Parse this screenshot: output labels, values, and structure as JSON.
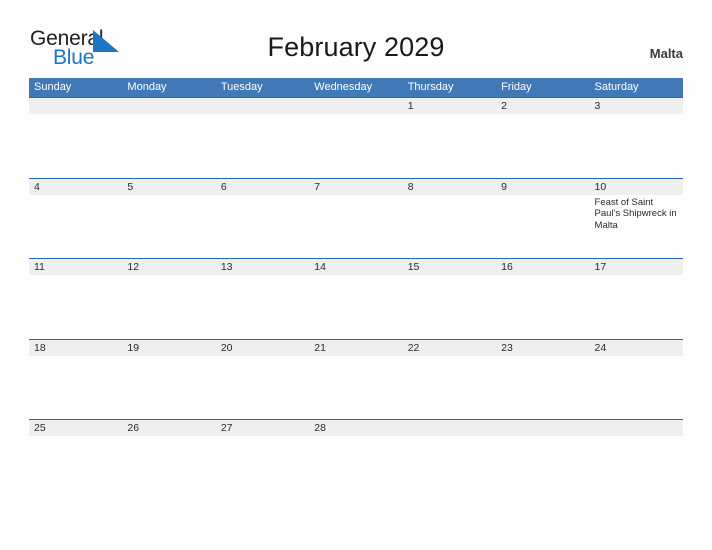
{
  "brand": {
    "name_part1": "General",
    "name_part2": "Blue",
    "triangle_icon": "triangle-right-icon",
    "color_dark": "#231f20",
    "color_blue": "#1c76c5"
  },
  "header": {
    "title": "February 2029",
    "region": "Malta",
    "accent_color": "#4178b8",
    "row_border_color": "#1f6eb5",
    "band_color": "#efefef"
  },
  "weekdays": [
    "Sunday",
    "Monday",
    "Tuesday",
    "Wednesday",
    "Thursday",
    "Friday",
    "Saturday"
  ],
  "weeks": [
    [
      {
        "day": "",
        "event": ""
      },
      {
        "day": "",
        "event": ""
      },
      {
        "day": "",
        "event": ""
      },
      {
        "day": "",
        "event": ""
      },
      {
        "day": "1",
        "event": ""
      },
      {
        "day": "2",
        "event": ""
      },
      {
        "day": "3",
        "event": ""
      }
    ],
    [
      {
        "day": "4",
        "event": ""
      },
      {
        "day": "5",
        "event": ""
      },
      {
        "day": "6",
        "event": ""
      },
      {
        "day": "7",
        "event": ""
      },
      {
        "day": "8",
        "event": ""
      },
      {
        "day": "9",
        "event": ""
      },
      {
        "day": "10",
        "event": "Feast of Saint Paul's Shipwreck in Malta"
      }
    ],
    [
      {
        "day": "11",
        "event": ""
      },
      {
        "day": "12",
        "event": ""
      },
      {
        "day": "13",
        "event": ""
      },
      {
        "day": "14",
        "event": ""
      },
      {
        "day": "15",
        "event": ""
      },
      {
        "day": "16",
        "event": ""
      },
      {
        "day": "17",
        "event": ""
      }
    ],
    [
      {
        "day": "18",
        "event": ""
      },
      {
        "day": "19",
        "event": ""
      },
      {
        "day": "20",
        "event": ""
      },
      {
        "day": "21",
        "event": ""
      },
      {
        "day": "22",
        "event": ""
      },
      {
        "day": "23",
        "event": ""
      },
      {
        "day": "24",
        "event": ""
      }
    ],
    [
      {
        "day": "25",
        "event": ""
      },
      {
        "day": "26",
        "event": ""
      },
      {
        "day": "27",
        "event": ""
      },
      {
        "day": "28",
        "event": ""
      },
      {
        "day": "",
        "event": ""
      },
      {
        "day": "",
        "event": ""
      },
      {
        "day": "",
        "event": ""
      }
    ]
  ]
}
